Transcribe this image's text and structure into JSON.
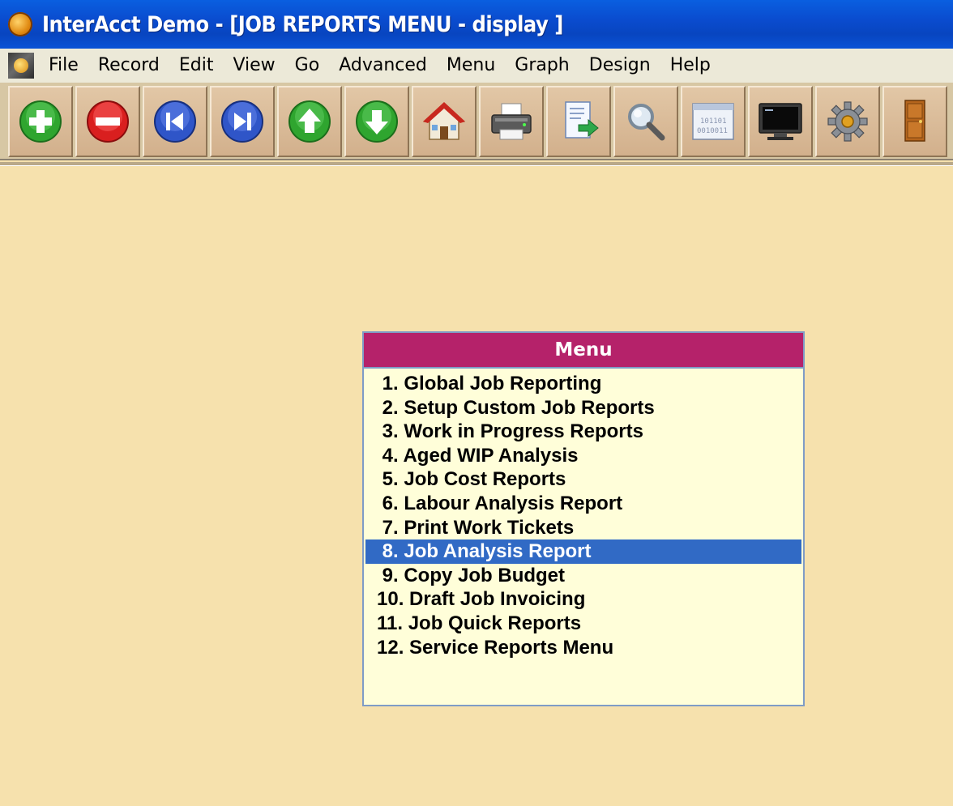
{
  "window": {
    "title": "InterAcct Demo - [JOB REPORTS MENU - display ]"
  },
  "menubar": {
    "items": [
      "File",
      "Record",
      "Edit",
      "View",
      "Go",
      "Advanced",
      "Menu",
      "Graph",
      "Design",
      "Help"
    ]
  },
  "toolbar": {
    "buttons": [
      "add",
      "delete",
      "first",
      "last",
      "previous",
      "next",
      "home",
      "print",
      "export",
      "search",
      "data",
      "screen",
      "settings",
      "exit"
    ]
  },
  "menu": {
    "header": "Menu",
    "selected_index": 7,
    "items": [
      " 1. Global Job Reporting",
      " 2. Setup Custom Job Reports",
      " 3. Work in Progress Reports",
      " 4. Aged WIP Analysis",
      " 5. Job Cost Reports",
      " 6. Labour Analysis Report",
      " 7. Print Work Tickets",
      " 8. Job Analysis Report",
      " 9. Copy Job Budget",
      "10. Draft Job Invoicing",
      "11. Job Quick Reports",
      "12. Service Reports Menu"
    ]
  },
  "colors": {
    "title_bar": "#0a4ccf",
    "workspace": "#f6e1ad",
    "menu_header": "#b5226a",
    "menu_body": "#fffed9",
    "selection": "#316ac5"
  }
}
